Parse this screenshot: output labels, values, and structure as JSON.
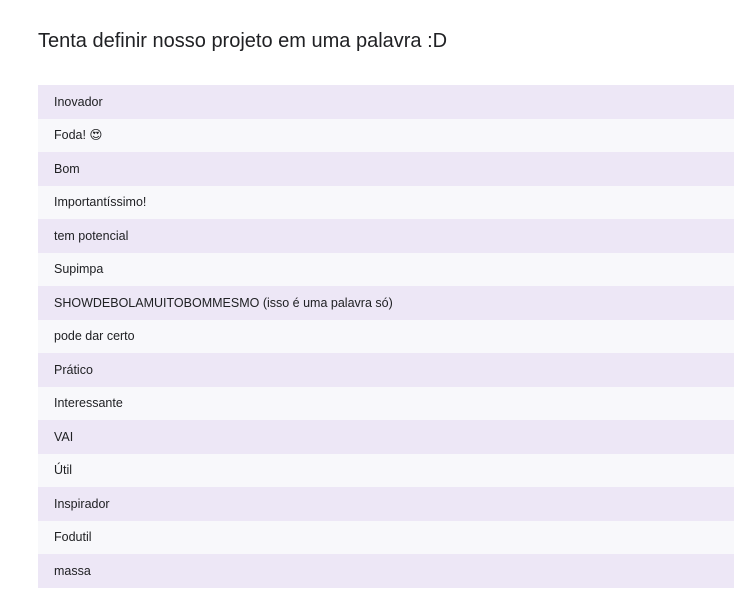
{
  "question": {
    "title": "Tenta definir nosso projeto em uma palavra :D",
    "responses": [
      "Inovador",
      "Foda! 😍",
      "Bom",
      "Importantíssimo!",
      "tem potencial",
      "Supimpa",
      "SHOWDEBOLAMUITOBOMMESMO (isso é uma palavra só)",
      "pode dar certo",
      "Prático",
      "Interessante",
      "VAI",
      "Útil",
      "Inspirador",
      "Fodutil",
      "massa"
    ]
  },
  "colors": {
    "row_odd": "#ede7f6",
    "row_even": "#f8f8fb",
    "text": "#202124"
  }
}
